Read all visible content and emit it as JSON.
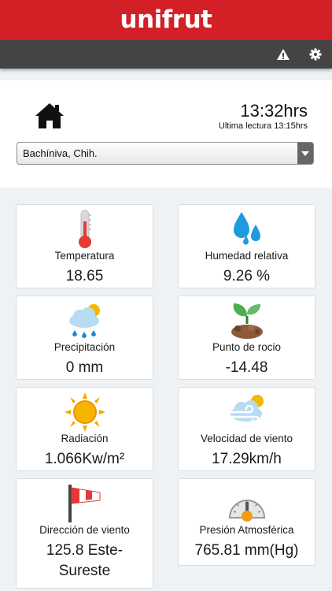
{
  "header": {
    "brand": "unifrut",
    "brand_color": "#d32027"
  },
  "toolbar": {
    "alert_icon": "warning-icon",
    "settings_icon": "gear-icon"
  },
  "status": {
    "time": "13:32hrs",
    "last_reading": "Ultima lectura 13:15hrs",
    "home_icon": "home-icon"
  },
  "station": {
    "selected": "Bachíniva, Chih."
  },
  "metrics": [
    {
      "label": "Temperatura",
      "value": "18.65",
      "icon": "thermometer-icon"
    },
    {
      "label": "Humedad relativa",
      "value": "9.26 %",
      "icon": "water-drops-icon"
    },
    {
      "label": "Precipitación",
      "value": "0 mm",
      "icon": "rain-cloud-icon"
    },
    {
      "label": "Punto de rocio",
      "value": "-14.48",
      "icon": "sprout-icon"
    },
    {
      "label": "Radiación",
      "value": "1.066Kw/m²",
      "icon": "sun-icon"
    },
    {
      "label": "Velocidad de viento",
      "value": "17.29km/h",
      "icon": "windy-cloud-icon"
    },
    {
      "label": "Dirección de viento",
      "value": "125.8 Este-Sureste",
      "icon": "windsock-icon"
    },
    {
      "label": "Presión Atmosférica",
      "value": "765.81 mm(Hg)",
      "icon": "barometer-icon"
    }
  ]
}
